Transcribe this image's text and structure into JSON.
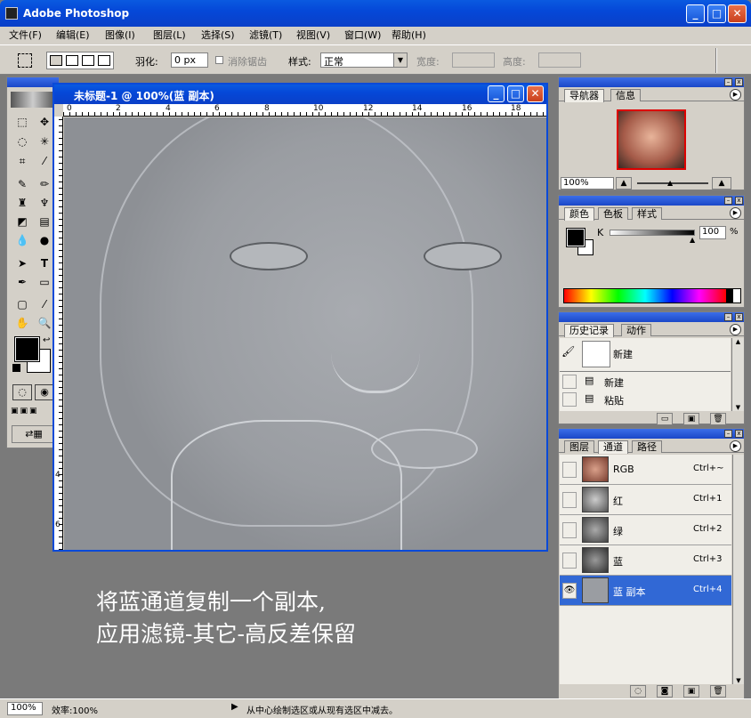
{
  "app": {
    "title": "Adobe Photoshop"
  },
  "menu": [
    "文件(F)",
    "编辑(E)",
    "图像(I)",
    "图层(L)",
    "选择(S)",
    "滤镜(T)",
    "视图(V)",
    "窗口(W)",
    "帮助(H)"
  ],
  "options": {
    "feather_label": "羽化:",
    "feather_value": "0 px",
    "antialias_label": "消除锯齿",
    "style_label": "样式:",
    "style_value": "正常",
    "width_label": "宽度:",
    "height_label": "高度:"
  },
  "document": {
    "title": "未标题-1 @ 100%(蓝 副本)",
    "ruler_h": [
      "0",
      "2",
      "4",
      "6",
      "8",
      "10",
      "12",
      "14",
      "16",
      "18"
    ],
    "ruler_v": [
      "4",
      "6"
    ]
  },
  "caption": {
    "line1": "将蓝通道复制一个副本,",
    "line2": "应用滤镜-其它-高反差保留"
  },
  "navigator": {
    "tabs": [
      "导航器",
      "信息"
    ],
    "zoom": "100%"
  },
  "color": {
    "tabs": [
      "颜色",
      "色板",
      "样式"
    ],
    "channel": "K",
    "value": "100",
    "unit": "%"
  },
  "history": {
    "tabs": [
      "历史记录",
      "动作"
    ],
    "snapshot": "新建",
    "items": [
      "新建",
      "粘贴"
    ]
  },
  "channels": {
    "tabs": [
      "图层",
      "通道",
      "路径"
    ],
    "rows": [
      {
        "name": "RGB",
        "shortcut": "Ctrl+~"
      },
      {
        "name": "红",
        "shortcut": "Ctrl+1"
      },
      {
        "name": "绿",
        "shortcut": "Ctrl+2"
      },
      {
        "name": "蓝",
        "shortcut": "Ctrl+3"
      },
      {
        "name": "蓝 副本",
        "shortcut": "Ctrl+4"
      }
    ]
  },
  "status": {
    "zoom": "100%",
    "efficiency": "效率:100%",
    "hint": "从中心绘制选区或从现有选区中减去。"
  },
  "colors": {
    "accent": "#0a5ae0",
    "selected_row": "#3168d5"
  }
}
